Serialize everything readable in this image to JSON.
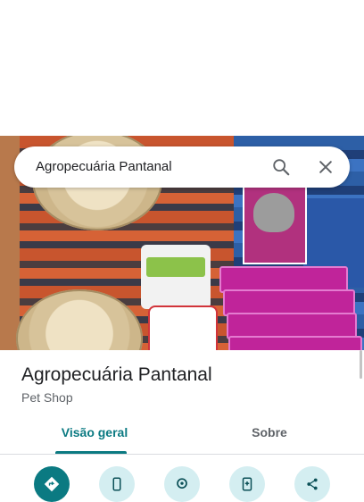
{
  "search": {
    "query": "Agropecuária Pantanal"
  },
  "icons": {
    "search": "search-icon",
    "close": "close-icon",
    "directions": "directions-icon",
    "phone": "phone-icon",
    "location": "location-icon",
    "save": "save-icon",
    "share": "share-icon"
  },
  "place": {
    "name": "Agropecuária Pantanal",
    "category": "Pet Shop"
  },
  "tabs": [
    {
      "label": "Visão geral",
      "active": true
    },
    {
      "label": "Sobre",
      "active": false
    }
  ],
  "colors": {
    "accent": "#0b7a82",
    "action_bg": "#d4eef1",
    "text_primary": "#202124",
    "text_secondary": "#5f6368"
  }
}
